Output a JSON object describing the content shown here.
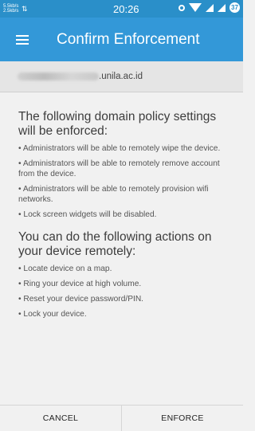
{
  "status_bar": {
    "net_speed_up": "5.5kb/s",
    "net_speed_down": "2.5kb/s",
    "time": "20:26",
    "battery_level": "37"
  },
  "app_bar": {
    "title": "Confirm Enforcement"
  },
  "account": {
    "domain_suffix": ".unila.ac.id"
  },
  "section1": {
    "heading": "The following domain policy settings will be enforced:",
    "items": [
      "• Administrators will be able to remotely wipe the device.",
      "• Administrators will be able to remotely remove account from the device.",
      "• Administrators will be able to remotely provision wifi networks.",
      "• Lock screen widgets will be disabled."
    ]
  },
  "section2": {
    "heading": "You can do the following actions on your device remotely:",
    "items": [
      "• Locate device on a map.",
      "• Ring your device at high volume.",
      "• Reset your device password/PIN.",
      "• Lock your device."
    ]
  },
  "buttons": {
    "cancel": "CANCEL",
    "enforce": "ENFORCE"
  },
  "colors": {
    "status_bar": "#2a8fc9",
    "app_bar": "#3398d8",
    "background": "#f1f1f1"
  }
}
